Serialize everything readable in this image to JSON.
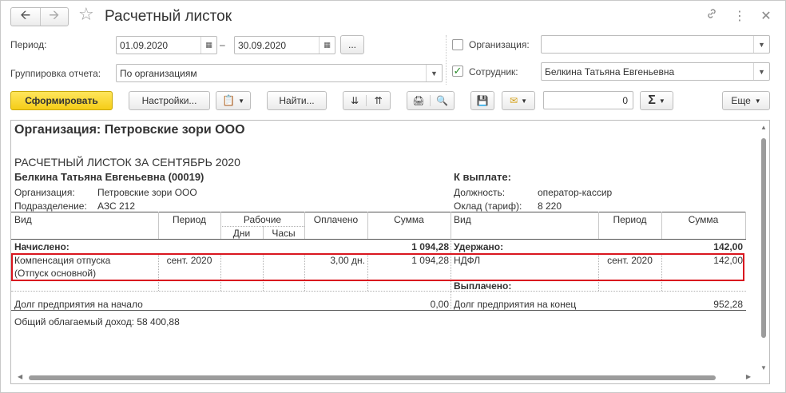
{
  "window": {
    "title": "Расчетный листок",
    "back_icon": "arrow-left-icon",
    "forward_icon": "arrow-right-icon",
    "star_icon": "star-icon",
    "link_icon": "link-icon",
    "more_icon": "more-vertical-icon",
    "close_icon": "close-icon"
  },
  "filters": {
    "period_label": "Период:",
    "period_from": "01.09.2020",
    "period_dash": "–",
    "period_to": "30.09.2020",
    "ellipsis": "...",
    "grouping_label": "Группировка отчета:",
    "grouping_value": "По организациям",
    "org_label": "Организация:",
    "org_checked": false,
    "org_value": "",
    "employee_label": "Сотрудник:",
    "employee_checked": true,
    "employee_value": "Белкина Татьяна Евгеньевна"
  },
  "toolbar": {
    "generate": "Сформировать",
    "settings": "Настройки...",
    "find": "Найти...",
    "amount": "0",
    "sum_symbol": "Σ",
    "more": "Еще"
  },
  "report": {
    "organization_title": "Организация: Петровские зори ООО",
    "sheet_title": "РАСЧЕТНЫЙ ЛИСТОК ЗА СЕНТЯБРЬ 2020",
    "employee_name": "Белкина Татьяна Евгеньевна (00019)",
    "to_pay_label": "К выплате:",
    "org_field_label": "Организация:",
    "org_field_value": "Петровские зори ООО",
    "dept_field_label": "Подразделение:",
    "dept_field_value": "АЗС 212",
    "position_label": "Должность:",
    "position_value": "оператор-кассир",
    "salary_label": "Оклад (тариф):",
    "salary_value": "8 220",
    "headers": {
      "kind": "Вид",
      "period": "Период",
      "working": "Рабочие",
      "days": "Дни",
      "hours": "Часы",
      "paid": "Оплачено",
      "sum": "Сумма",
      "kind_r": "Вид",
      "period_r": "Период",
      "sum_r": "Сумма"
    },
    "accrued_label": "Начислено:",
    "accrued_total": "1 094,28",
    "withheld_label": "Удержано:",
    "withheld_total": "142,00",
    "accrual_row": {
      "kind_line1": "Компенсация отпуска",
      "kind_line2": "(Отпуск основной)",
      "period": "сент. 2020",
      "paid": "3,00 дн.",
      "sum": "1 094,28"
    },
    "withholding_row": {
      "kind": "НДФЛ",
      "period": "сент. 2020",
      "sum": "142,00"
    },
    "paid_out_label": "Выплачено:",
    "debt_start_label": "Долг предприятия на начало",
    "debt_start_value": "0,00",
    "debt_end_label": "Долг предприятия на конец",
    "debt_end_value": "952,28",
    "taxable_income": "Общий облагаемый доход: 58 400,88"
  }
}
